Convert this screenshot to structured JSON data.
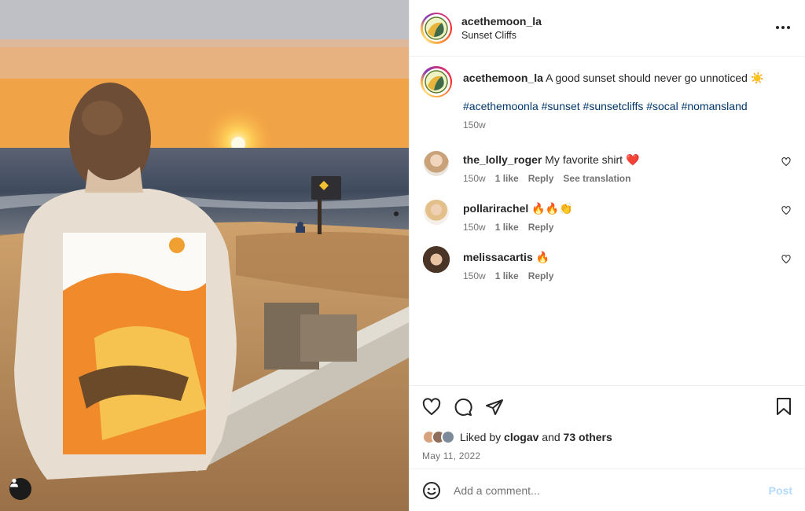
{
  "post": {
    "username": "acethemoon_la",
    "location": "Sunset Cliffs",
    "more_icon": "more-horizontal-icon",
    "caption": "A good sunset should never go unnoticed ☀️",
    "hashtags": "#acethemoonla #sunset #sunsetcliffs #socal #nomansland",
    "caption_age": "150w"
  },
  "comments": [
    {
      "username": "the_lolly_roger",
      "text": "My favorite shirt ❤️",
      "age": "150w",
      "likes": "1 like",
      "reply": "Reply",
      "translate": "See translation"
    },
    {
      "username": "pollarirachel",
      "text": "🔥🔥👏",
      "age": "150w",
      "likes": "1 like",
      "reply": "Reply"
    },
    {
      "username": "melissacartis",
      "text": "🔥",
      "age": "150w",
      "likes": "1 like",
      "reply": "Reply"
    }
  ],
  "likes": {
    "prefix": "Liked by",
    "user": "clogav",
    "and": "and",
    "others": "73 others"
  },
  "date": "May 11, 2022",
  "add_comment": {
    "placeholder": "Add a comment...",
    "post_label": "Post"
  },
  "colors": {
    "link": "#00376b",
    "muted": "#737373",
    "post_disabled": "#b3dbff",
    "heart_red": "#ff3040"
  }
}
